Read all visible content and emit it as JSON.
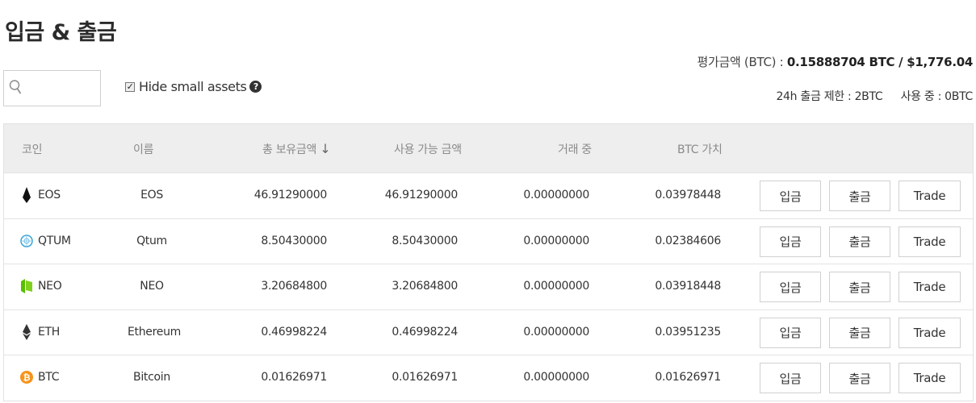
{
  "page": {
    "title": "입금 & 출금"
  },
  "summary": {
    "label": "평가금액 (BTC) :",
    "value": "0.15888704 BTC / $1,776.04",
    "limit": "24h 출금 제한 : 2BTC",
    "in_use": "사용 중 : 0BTC"
  },
  "search": {
    "placeholder": "",
    "icon": "search-icon"
  },
  "filter": {
    "hide_small_label": "Hide small assets",
    "hide_small_checked": true,
    "help": "?"
  },
  "table": {
    "columns": {
      "coin": "코인",
      "name": "이름",
      "total": "총 보유금액",
      "available": "사용 가능 금액",
      "in_order": "거래 중",
      "btc_value": "BTC 가치"
    },
    "sort_indicator": "↓",
    "rows": [
      {
        "symbol": "EOS",
        "name": "EOS",
        "total": "46.91290000",
        "available": "46.91290000",
        "in_order": "0.00000000",
        "btc_value": "0.03978448",
        "deposit": "입금",
        "withdraw": "출금",
        "trade": "Trade",
        "icon": "eos-icon",
        "color": "#111111"
      },
      {
        "symbol": "QTUM",
        "name": "Qtum",
        "total": "8.50430000",
        "available": "8.50430000",
        "in_order": "0.00000000",
        "btc_value": "0.02384606",
        "deposit": "입금",
        "withdraw": "출금",
        "trade": "Trade",
        "icon": "qtum-icon",
        "color": "#2e9ad0"
      },
      {
        "symbol": "NEO",
        "name": "NEO",
        "total": "3.20684800",
        "available": "3.20684800",
        "in_order": "0.00000000",
        "btc_value": "0.03918448",
        "deposit": "입금",
        "withdraw": "출금",
        "trade": "Trade",
        "icon": "neo-icon",
        "color": "#58bf00"
      },
      {
        "symbol": "ETH",
        "name": "Ethereum",
        "total": "0.46998224",
        "available": "0.46998224",
        "in_order": "0.00000000",
        "btc_value": "0.03951235",
        "deposit": "입금",
        "withdraw": "출금",
        "trade": "Trade",
        "icon": "eth-icon",
        "color": "#333333"
      },
      {
        "symbol": "BTC",
        "name": "Bitcoin",
        "total": "0.01626971",
        "available": "0.01626971",
        "in_order": "0.00000000",
        "btc_value": "0.01626971",
        "deposit": "입금",
        "withdraw": "출금",
        "trade": "Trade",
        "icon": "btc-icon",
        "color": "#f7931a"
      }
    ]
  }
}
